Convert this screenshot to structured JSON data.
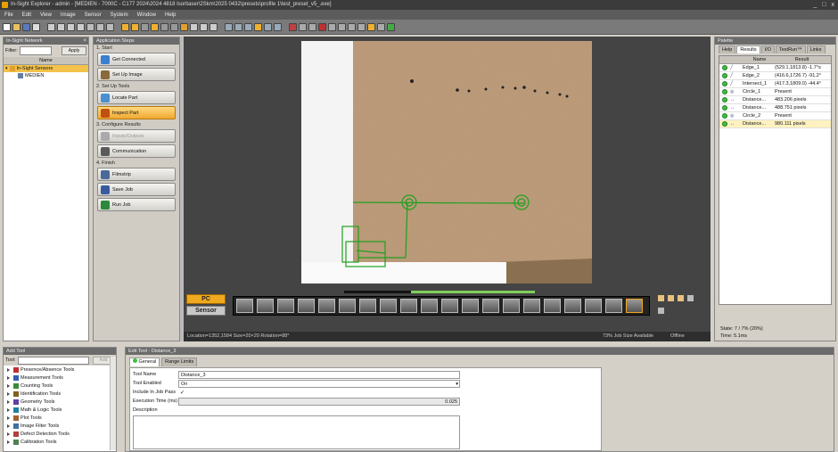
{
  "window": {
    "title": "In-Sight Explorer - admin - [MEDIEN - 7000C - C177 2024\\2024 4818 Isoritaser\\2Skm\\2025 0432\\presets\\profile 1\\test_preset_v5_.exe]",
    "controls": [
      "_",
      "□",
      "x"
    ]
  },
  "menu": [
    "File",
    "Edit",
    "View",
    "Image",
    "Sensor",
    "System",
    "Window",
    "Help"
  ],
  "network": {
    "title": "In-Sight Network",
    "filter_label": "Filter:",
    "apply": "Apply",
    "column": "Name",
    "items": [
      {
        "label": "In-Sight Sensors",
        "level": 0,
        "selected": true
      },
      {
        "label": "MEDIEN",
        "level": 1,
        "selected": false
      }
    ]
  },
  "steps": {
    "title": "Application Steps",
    "sections": [
      {
        "label": "1. Start",
        "buttons": [
          {
            "label": "Get Connected",
            "state": "normal",
            "icon_color": "#3a7fd0"
          },
          {
            "label": "Set Up Image",
            "state": "normal",
            "icon_color": "#8a6a3a"
          }
        ]
      },
      {
        "label": "2. Set Up Tools",
        "buttons": [
          {
            "label": "Locate Part",
            "state": "normal",
            "icon_color": "#4a90d0"
          },
          {
            "label": "Inspect Part",
            "state": "active",
            "icon_color": "#c05010"
          }
        ]
      },
      {
        "label": "3. Configure Results",
        "buttons": [
          {
            "label": "Inputs/Outputs",
            "state": "disabled",
            "icon_color": "#aaaaaa"
          },
          {
            "label": "Communication",
            "state": "normal",
            "icon_color": "#5a5a5a"
          }
        ]
      },
      {
        "label": "4. Finish",
        "buttons": [
          {
            "label": "Filmstrip",
            "state": "normal",
            "icon_color": "#4a6a9a"
          },
          {
            "label": "Save Job",
            "state": "normal",
            "icon_color": "#3a5aa0"
          },
          {
            "label": "Run Job",
            "state": "normal",
            "icon_color": "#2a8a3a"
          }
        ]
      }
    ]
  },
  "viewer": {
    "pc": "PC",
    "sensor": "Sensor",
    "frames": 20,
    "current_frame": 20,
    "status_location": "Location=1352,1584 Size=20×20 Rotation=88°",
    "status_job": "73% Job Size Available",
    "status_mode": "Offline",
    "progress": 0.65
  },
  "palette": {
    "title": "Palette",
    "tabs": [
      "Help",
      "Results",
      "I/O",
      "TestRun™",
      "Links"
    ],
    "active_tab": "Results",
    "columns": [
      "",
      "",
      "",
      "Name",
      "Result"
    ],
    "rows": [
      {
        "name": "Edge_1",
        "result": "(529.1,1813.8) -1.7°s"
      },
      {
        "name": "Edge_2",
        "result": "(416.6,1726.7) -91.2°"
      },
      {
        "name": "Intersect_1",
        "result": "(417.3,1809.0) -44.4°"
      },
      {
        "name": "Circle_1",
        "result": "Present"
      },
      {
        "name": "Distance...",
        "result": "483.206 pixels"
      },
      {
        "name": "Distance...",
        "result": "488.751 pixels"
      },
      {
        "name": "Circle_2",
        "result": "Present"
      },
      {
        "name": "Distance...",
        "result": "980.111 pixels",
        "selected": true
      }
    ],
    "footer_state": "State: 7 / 7% (20%)",
    "footer_time": "Time: 5.1ms"
  },
  "addtool": {
    "title": "Add Tool",
    "filter_label": "Tool:",
    "add": "Add",
    "items": [
      "Presence/Absence Tools",
      "Measurement Tools",
      "Counting Tools",
      "Identification Tools",
      "Geometry Tools",
      "Math & Logic Tools",
      "Plot Tools",
      "Image Filter Tools",
      "Defect Detection Tools",
      "Calibration Tools"
    ]
  },
  "edit": {
    "title": "Edit Tool - Distance_3",
    "tabs": [
      "General",
      "Range Limits"
    ],
    "active_tab": "General",
    "fields": {
      "tool_name_label": "Tool Name",
      "tool_name": "Distance_3",
      "enabled_label": "Tool Enabled",
      "enabled": "On",
      "include_label": "Include In Job Pass",
      "exec_label": "Execution Time (ms)",
      "exec": "0.025",
      "desc_label": "Description"
    }
  }
}
